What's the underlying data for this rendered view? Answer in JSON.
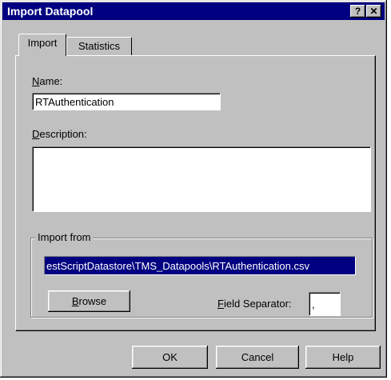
{
  "window": {
    "title": "Import Datapool",
    "help_glyph": "?",
    "close_glyph": "✕"
  },
  "tabs": [
    {
      "label": "Import"
    },
    {
      "label": "Statistics"
    }
  ],
  "name": {
    "label_prefix": "N",
    "label_rest": "ame:",
    "value": "RTAuthentication"
  },
  "description": {
    "label_prefix": "D",
    "label_rest": "escription:",
    "value": ""
  },
  "import_from": {
    "group_label": "Import from",
    "path_value": "estScriptDatastore\\TMS_Datapools\\RTAuthentication.csv",
    "browse_prefix": "B",
    "browse_rest": "rowse",
    "field_sep_prefix": "F",
    "field_sep_rest": "ield Separator:",
    "field_sep_value": ","
  },
  "buttons": {
    "ok": "OK",
    "cancel": "Cancel",
    "help": "Help"
  }
}
